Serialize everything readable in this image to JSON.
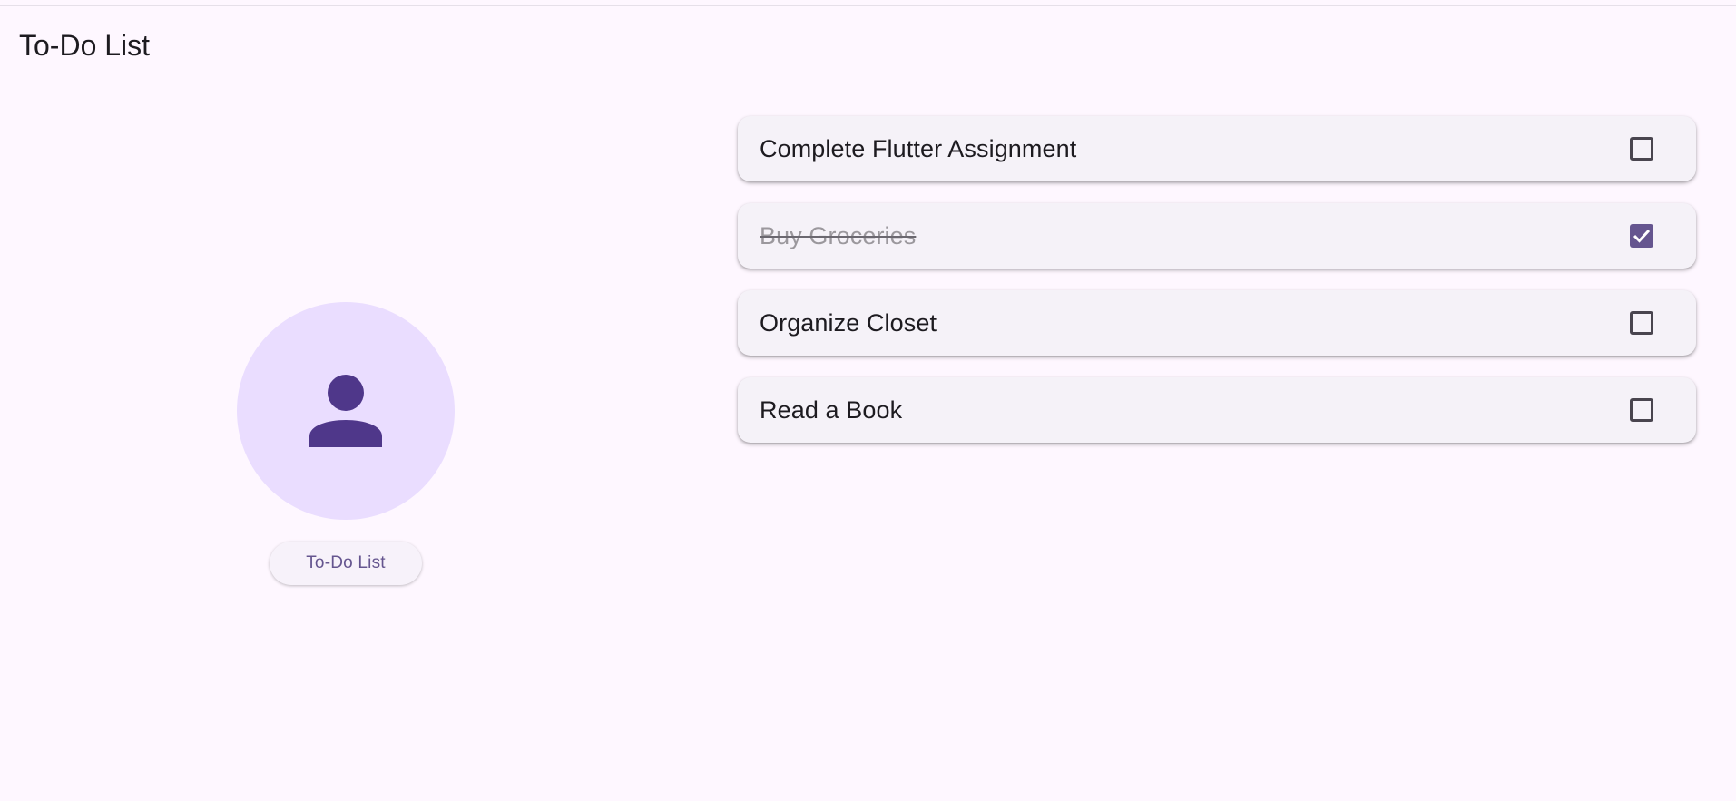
{
  "app_bar": {
    "title": "To-Do List"
  },
  "profile": {
    "avatar_icon": "person-icon",
    "button_label": "To-Do List"
  },
  "tasks": [
    {
      "title": "Complete Flutter Assignment",
      "done": false
    },
    {
      "title": "Buy Groceries",
      "done": true
    },
    {
      "title": "Organize Closet",
      "done": false
    },
    {
      "title": "Read a Book",
      "done": false
    }
  ],
  "colors": {
    "background": "#fef7ff",
    "primary": "#65558f",
    "avatar_bg": "#eaddff",
    "avatar_icon": "#4f378a",
    "card_bg": "#f5f2f8"
  }
}
